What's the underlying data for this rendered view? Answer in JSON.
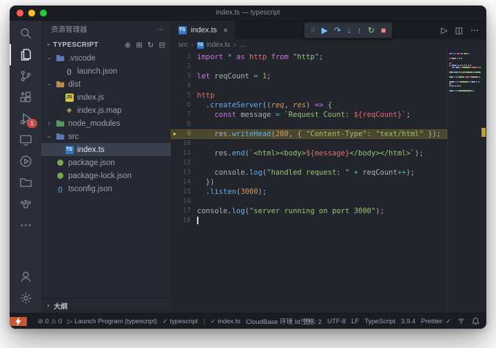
{
  "window": {
    "title": "index.ts — typescript"
  },
  "activity_bar": {
    "items": [
      {
        "name": "search",
        "active": false
      },
      {
        "name": "explorer",
        "active": true
      },
      {
        "name": "source-control",
        "active": false
      },
      {
        "name": "extensions",
        "active": false
      },
      {
        "name": "run-and-debug",
        "active": false,
        "badge": "1"
      },
      {
        "name": "remote-explorer",
        "active": false
      },
      {
        "name": "test-explorer",
        "active": false
      },
      {
        "name": "library",
        "active": false
      },
      {
        "name": "cloudbase",
        "active": false
      },
      {
        "name": "more",
        "active": false
      }
    ],
    "bottom_items": [
      {
        "name": "accounts"
      },
      {
        "name": "settings"
      }
    ]
  },
  "sidebar": {
    "header": "资源管理器",
    "section": "TYPESCRIPT",
    "section_actions": [
      {
        "name": "new-file",
        "glyph": "⊕"
      },
      {
        "name": "new-folder",
        "glyph": "⊞"
      },
      {
        "name": "refresh",
        "glyph": "↻"
      },
      {
        "name": "collapse-all",
        "glyph": "⊟"
      }
    ],
    "tree": [
      {
        "label": ".vscode",
        "icon": "folder",
        "color": "#5d77b8",
        "depth": 0,
        "chev": "exp"
      },
      {
        "label": "launch.json",
        "icon": "json",
        "color": "#9aa2b1",
        "depth": 1
      },
      {
        "label": "dist",
        "icon": "folder",
        "color": "#b9884e",
        "depth": 0,
        "chev": "exp"
      },
      {
        "label": "index.js",
        "icon": "js",
        "color": "#d7c64a",
        "depth": 1
      },
      {
        "label": "index.js.map",
        "icon": "map",
        "color": "#cbb552",
        "depth": 1
      },
      {
        "label": "node_modules",
        "icon": "folder",
        "color": "#549a62",
        "depth": 0,
        "chev": "col"
      },
      {
        "label": "src",
        "icon": "folder",
        "color": "#5d77b8",
        "depth": 0,
        "chev": "exp"
      },
      {
        "label": "index.ts",
        "icon": "ts",
        "color": "#3178c6",
        "depth": 1,
        "selected": true
      },
      {
        "label": "package.json",
        "icon": "npm",
        "color": "#7da453",
        "depth": 0
      },
      {
        "label": "package-lock.json",
        "icon": "npm",
        "color": "#7da453",
        "depth": 0
      },
      {
        "label": "tsconfig.json",
        "icon": "json",
        "color": "#519aba",
        "depth": 0
      }
    ],
    "outline": "大纲"
  },
  "editor": {
    "tab": {
      "label": "index.ts"
    },
    "breadcrumb": [
      "src",
      "index.ts",
      "…"
    ],
    "token_colors": {
      "kw": "#c678dd",
      "str": "#98c379",
      "num": "#d19a66",
      "fn": "#61afef",
      "def": "#abb2bf",
      "var": "#e06c75",
      "op": "#56b6c2",
      "param": "#d19a66"
    },
    "lines": [
      {
        "n": "1",
        "tokens": [
          [
            "kw",
            "import"
          ],
          [
            "op",
            " * "
          ],
          [
            "kw",
            "as"
          ],
          [
            "var",
            " http"
          ],
          [
            "kw",
            " from"
          ],
          [
            "str",
            " \"http\""
          ],
          [
            "def",
            ";"
          ]
        ]
      },
      {
        "n": "2",
        "tokens": []
      },
      {
        "n": "3",
        "tokens": [
          [
            "kw",
            "let"
          ],
          [
            "def",
            " reqCount "
          ],
          [
            "op",
            "="
          ],
          [
            "num",
            " 1"
          ],
          [
            "def",
            ";"
          ]
        ]
      },
      {
        "n": "4",
        "tokens": []
      },
      {
        "n": "5",
        "tokens": [
          [
            "var",
            "http"
          ]
        ]
      },
      {
        "n": "6",
        "tokens": [
          [
            "def",
            "  ."
          ],
          [
            "fn",
            "createServer"
          ],
          [
            "def",
            "(("
          ],
          [
            "param",
            "req"
          ],
          [
            "def",
            ", "
          ],
          [
            "param",
            "res"
          ],
          [
            "def",
            ") "
          ],
          [
            "kw",
            "=>"
          ],
          [
            "def",
            " {"
          ]
        ]
      },
      {
        "n": "7",
        "tokens": [
          [
            "def",
            "    "
          ],
          [
            "kw",
            "const"
          ],
          [
            "def",
            " message "
          ],
          [
            "op",
            "="
          ],
          [
            "str",
            " `Request Count: "
          ],
          [
            "var",
            "${reqCount}"
          ],
          [
            "str",
            "`"
          ],
          [
            "def",
            ";"
          ]
        ]
      },
      {
        "n": "8",
        "tokens": []
      },
      {
        "n": "9",
        "hl": true,
        "debug_arrow": true,
        "tokens": [
          [
            "def",
            "    res."
          ],
          [
            "fn",
            "writeHead"
          ],
          [
            "def",
            "("
          ],
          [
            "num",
            "200"
          ],
          [
            "def",
            ", { "
          ],
          [
            "str",
            "\"Content-Type\""
          ],
          [
            "def",
            ": "
          ],
          [
            "str",
            "\"text/html\""
          ],
          [
            "def",
            " });"
          ]
        ]
      },
      {
        "n": "10",
        "tokens": []
      },
      {
        "n": "11",
        "tokens": [
          [
            "def",
            "    res."
          ],
          [
            "fn",
            "end"
          ],
          [
            "def",
            "("
          ],
          [
            "str",
            "`<html><body>"
          ],
          [
            "var",
            "${message}"
          ],
          [
            "str",
            "</body></html>`"
          ],
          [
            "def",
            ");"
          ]
        ]
      },
      {
        "n": "12",
        "tokens": []
      },
      {
        "n": "13",
        "tokens": [
          [
            "def",
            "    console."
          ],
          [
            "fn",
            "log"
          ],
          [
            "def",
            "("
          ],
          [
            "str",
            "\"handled request: \""
          ],
          [
            "op",
            " + "
          ],
          [
            "def",
            "reqCount"
          ],
          [
            "op",
            "++"
          ],
          [
            "def",
            ");"
          ]
        ]
      },
      {
        "n": "14",
        "tokens": [
          [
            "def",
            "  })"
          ]
        ]
      },
      {
        "n": "15",
        "tokens": [
          [
            "def",
            "  ."
          ],
          [
            "fn",
            "listen"
          ],
          [
            "def",
            "("
          ],
          [
            "num",
            "3000"
          ],
          [
            "def",
            ");"
          ]
        ]
      },
      {
        "n": "16",
        "tokens": []
      },
      {
        "n": "17",
        "tokens": [
          [
            "def",
            "console."
          ],
          [
            "fn",
            "log"
          ],
          [
            "def",
            "("
          ],
          [
            "str",
            "\"server running on port 3000\""
          ],
          [
            "def",
            ");"
          ]
        ]
      },
      {
        "n": "18",
        "cursor": true,
        "tokens": []
      }
    ]
  },
  "debug_toolbar": {
    "buttons": [
      {
        "name": "continue",
        "glyph": "▶",
        "color": "#75beff"
      },
      {
        "name": "step-over",
        "glyph": "↷",
        "color": "#75beff"
      },
      {
        "name": "step-into",
        "glyph": "↓",
        "color": "#75beff"
      },
      {
        "name": "step-out",
        "glyph": "↑",
        "color": "#75beff"
      },
      {
        "name": "restart",
        "glyph": "↻",
        "color": "#89d185"
      },
      {
        "name": "stop",
        "glyph": "■",
        "color": "#f48771"
      }
    ]
  },
  "editor_actions": [
    {
      "name": "run",
      "glyph": "▷"
    },
    {
      "name": "split-editor",
      "glyph": "◫"
    },
    {
      "name": "more-actions",
      "glyph": "⋯"
    }
  ],
  "status_bar": {
    "errors": "0",
    "warnings": "0",
    "debug_status": "Launch Program (typescript)",
    "linter": "typescript",
    "file_check": "index.ts",
    "cloudbase": "CloudBase 环境 Id: 空",
    "spaces": "空格: 2",
    "encoding": "UTF-8",
    "eol": "LF",
    "language": "TypeScript",
    "version": "3.9.4",
    "prettier": "Prettier: ✓"
  },
  "colors": {
    "accent": "#3178c6",
    "highlight_line": "#cdb437",
    "remote_indicator": "#c35a33",
    "debug_badge": "#c84e4e"
  }
}
